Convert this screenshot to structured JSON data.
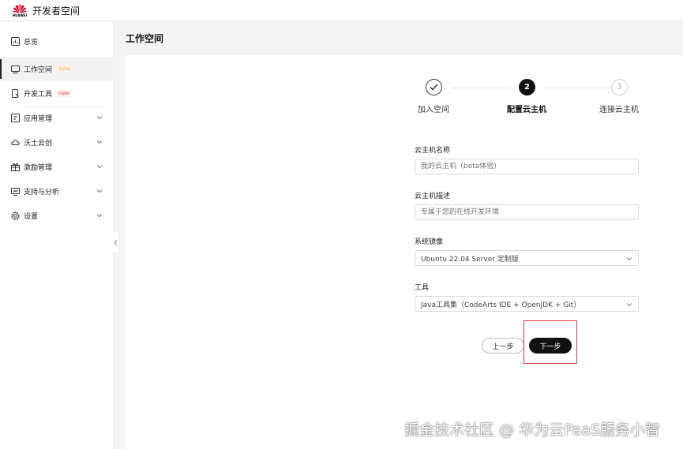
{
  "header": {
    "logo_text": "HUAWEI",
    "app_title": "开发者空间"
  },
  "sidebar": {
    "items": [
      {
        "label": "总览",
        "icon": "dashboard-icon"
      },
      {
        "label": "工作空间",
        "tag": "beta",
        "icon": "workspace-icon",
        "active": true
      },
      {
        "label": "开发工具",
        "tag": "new",
        "icon": "dev-tools-icon"
      },
      {
        "label": "应用管理",
        "icon": "app-manage-icon"
      },
      {
        "label": "沃土云创",
        "icon": "cloud-icon"
      },
      {
        "label": "激励管理",
        "icon": "gift-icon"
      },
      {
        "label": "支持与分析",
        "icon": "support-icon"
      },
      {
        "label": "设置",
        "icon": "gear-icon"
      }
    ]
  },
  "page": {
    "title": "工作空间"
  },
  "steps": [
    {
      "number": "✓",
      "label": "加入空间",
      "state": "done"
    },
    {
      "number": "2",
      "label": "配置云主机",
      "state": "current"
    },
    {
      "number": "3",
      "label": "连接云主机",
      "state": "pending"
    }
  ],
  "form": {
    "name_label": "云主机名称",
    "name_placeholder": "我的云主机（beta体验）",
    "desc_label": "云主机描述",
    "desc_placeholder": "专属于您的在线开发环境",
    "image_label": "系统镜像",
    "image_value": "Ubuntu 22.04 Server 定制版",
    "tools_label": "工具",
    "tools_value": "Java工具集（CodeArts IDE + OpenJDK + Git）"
  },
  "buttons": {
    "prev": "上一步",
    "next": "下一步"
  },
  "watermark": "掘金技术社区 @ 华为云PaaS服务小智",
  "colors": {
    "accent": "#111111",
    "highlight": "#e0353a",
    "logo_red": "#cf0a2c"
  }
}
